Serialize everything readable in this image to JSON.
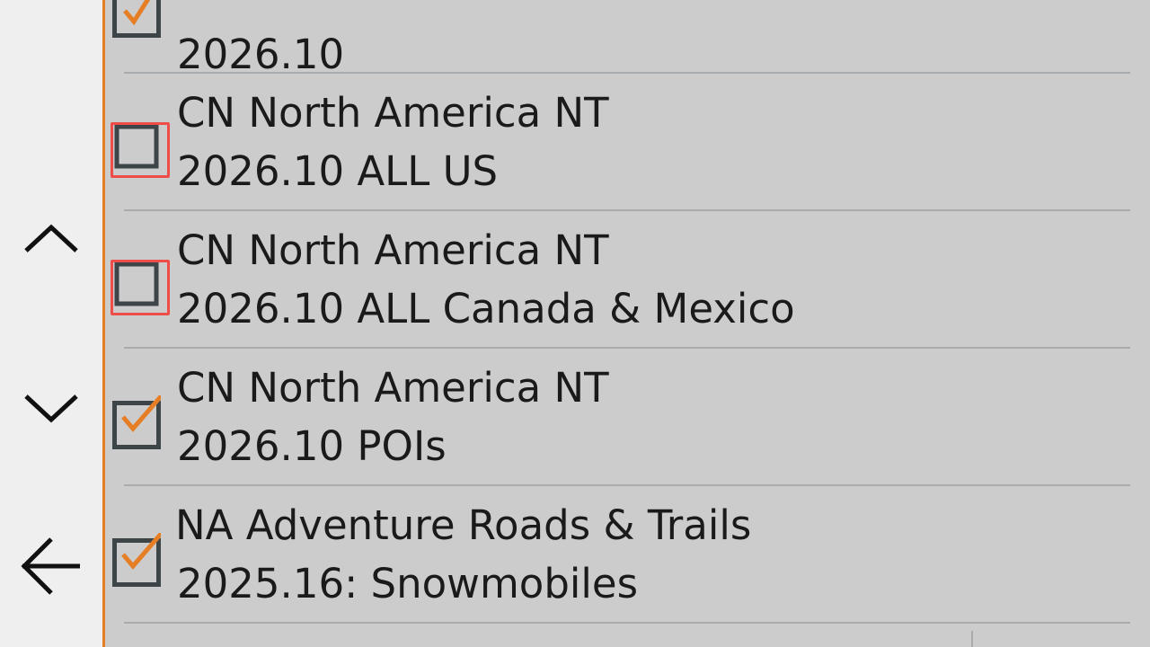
{
  "nav": {
    "up_icon": "chevron-up-icon",
    "down_icon": "chevron-down-icon",
    "back_icon": "arrow-left-icon"
  },
  "colors": {
    "accent": "#e57e25",
    "highlight": "#ef4d49",
    "list_bg": "#cccccc",
    "sidebar_bg": "#efefef",
    "checkbox_border": "#3d4549"
  },
  "maps": [
    {
      "line1": "",
      "line2": "2026.10",
      "checked": true
    },
    {
      "line1": "CN North America NT",
      "line2": "2026.10 ALL US",
      "checked": false
    },
    {
      "line1": "CN North America NT",
      "line2": "2026.10 ALL Canada & Mexico",
      "checked": false
    },
    {
      "line1": "CN North America NT",
      "line2": "2026.10 POIs",
      "checked": true
    },
    {
      "line1": "NA Adventure Roads & Trails",
      "line2": "2025.16: Snowmobiles",
      "checked": true
    }
  ]
}
